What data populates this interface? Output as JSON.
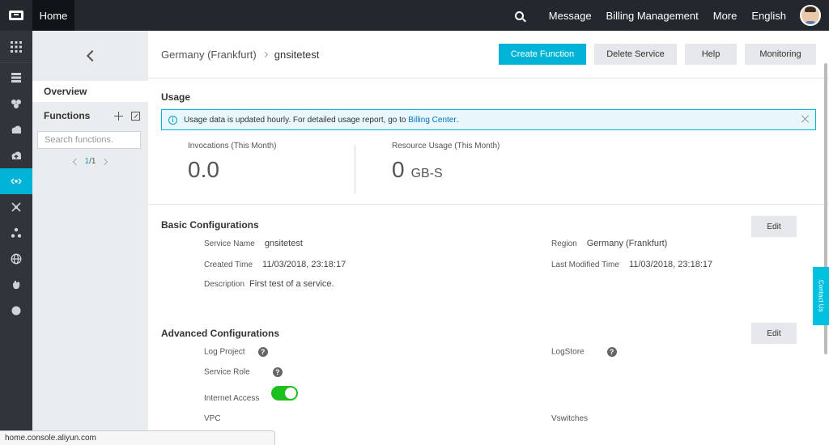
{
  "topbar": {
    "home": "Home",
    "links": [
      "Message",
      "Billing Management",
      "More",
      "English"
    ]
  },
  "iconbar": {
    "items": [
      "apps-icon",
      "server-icon",
      "flower-icon",
      "cloud-icon",
      "cloud-upload-icon",
      "function-compute-icon",
      "network-icon",
      "cluster-icon",
      "globe-icon",
      "hand-icon",
      "circle-icon"
    ],
    "active_index": 5
  },
  "sidebar": {
    "overview": "Overview",
    "functions": "Functions",
    "search_placeholder": "Search functions.",
    "pager_current": "1",
    "pager_total": "/1"
  },
  "header": {
    "region": "Germany (Frankfurt)",
    "service": "gnsitetest",
    "buttons": {
      "create": "Create Function",
      "delete": "Delete Service",
      "help": "Help",
      "monitoring": "Monitoring"
    }
  },
  "usage": {
    "title": "Usage",
    "alert_text": "Usage data is updated hourly. For detailed usage report, go to",
    "alert_link": "Billing Center",
    "alert_tail": ".",
    "invocations_label": "Invocations (This Month)",
    "invocations_value": "0.0",
    "resource_label": "Resource Usage (This Month)",
    "resource_value": "0",
    "resource_unit": "GB-S"
  },
  "basic": {
    "title": "Basic Configurations",
    "edit": "Edit",
    "service_name_label": "Service Name",
    "service_name": "gnsitetest",
    "region_label": "Region",
    "region": "Germany (Frankfurt)",
    "created_label": "Created Time",
    "created": "11/03/2018, 23:18:17",
    "modified_label": "Last Modified Time",
    "modified": "11/03/2018, 23:18:17",
    "description_label": "Description",
    "description": "First test of a service."
  },
  "advanced": {
    "title": "Advanced Configurations",
    "edit": "Edit",
    "log_project_label": "Log Project",
    "logstore_label": "LogStore",
    "service_role_label": "Service Role",
    "internet_access_label": "Internet Access",
    "internet_access_on": true,
    "vpc_label": "VPC",
    "vswitches_label": "Vswitches"
  },
  "contact": "Contact Us",
  "status_url": "home.console.aliyun.com",
  "colors": {
    "accent": "#00b4d8",
    "topbar": "#23272e",
    "toggle_on": "#1dc11d"
  }
}
